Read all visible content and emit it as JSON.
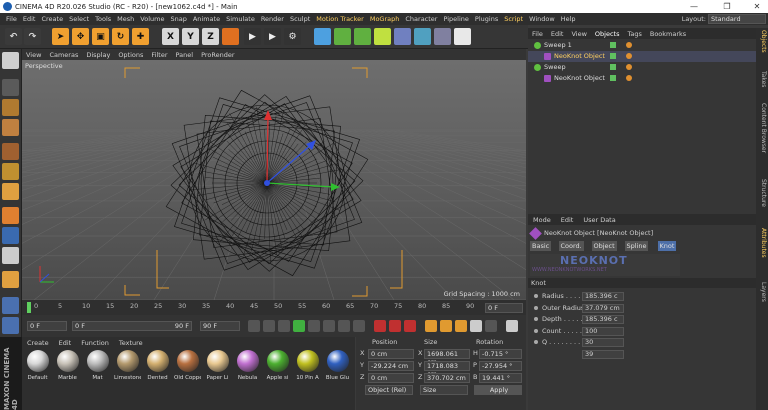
{
  "window": {
    "title": "CINEMA 4D R20.026 Studio (RC - R20) - [new1062.c4d *] - Main",
    "minimize": "—",
    "restore": "❐",
    "close": "✕"
  },
  "menubar": {
    "items": [
      "File",
      "Edit",
      "Create",
      "Select",
      "Tools",
      "Mesh",
      "Volume",
      "Snap",
      "Animate",
      "Simulate",
      "Render",
      "Sculpt",
      "Motion Tracker",
      "MoGraph",
      "Character",
      "Pipeline",
      "Plugins",
      "Script",
      "Window",
      "Help"
    ],
    "layout_label": "Layout:",
    "layout_value": "Standard"
  },
  "toolbar": {
    "axis_x": "X",
    "axis_y": "Y",
    "axis_z": "Z"
  },
  "viewport": {
    "menu": [
      "View",
      "Cameras",
      "Display",
      "Options",
      "Filter",
      "Panel",
      "ProRender"
    ],
    "label": "Perspective",
    "grid_spacing": "Grid Spacing : 1000 cm"
  },
  "timeline": {
    "ticks": [
      "0",
      "5",
      "10",
      "15",
      "20",
      "25",
      "30",
      "35",
      "40",
      "45",
      "50",
      "55",
      "60",
      "65",
      "70",
      "75",
      "80",
      "85",
      "90"
    ],
    "frame_display": "0 F"
  },
  "transport": {
    "start": "0 F",
    "current": "0 F",
    "end_a": "90 F",
    "end_b": "90 F"
  },
  "materials": {
    "menu": [
      "Create",
      "Edit",
      "Function",
      "Texture"
    ],
    "items": [
      {
        "name": "Default",
        "color": "#d8d8d8"
      },
      {
        "name": "Marble",
        "color": "#c8c2b8"
      },
      {
        "name": "Mat",
        "color": "#bdbdbd"
      },
      {
        "name": "Limestone",
        "color": "#b49a6e"
      },
      {
        "name": "Dented",
        "color": "#d4b070"
      },
      {
        "name": "Old Copper",
        "color": "#b87040"
      },
      {
        "name": "Paper Li",
        "color": "#e8c890"
      },
      {
        "name": "Nebula",
        "color": "#c070d0"
      },
      {
        "name": "Apple si",
        "color": "#4cb030"
      },
      {
        "name": "10 Pin A",
        "color": "#c0c020"
      },
      {
        "name": "Blue Glu",
        "color": "#3060c0"
      }
    ]
  },
  "coordinates": {
    "headers": [
      "Position",
      "Size",
      "Rotation"
    ],
    "rows": [
      {
        "axis": "X",
        "pos": "0 cm",
        "size_axis": "X",
        "size": "1698.061 cm",
        "rot_axis": "H",
        "rot": "-0.715 °"
      },
      {
        "axis": "Y",
        "pos": "-29.224 cm",
        "size_axis": "Y",
        "size": "1718.083 cm",
        "rot_axis": "P",
        "rot": "-27.954 °"
      },
      {
        "axis": "Z",
        "pos": "0 cm",
        "size_axis": "Z",
        "size": "370.702 cm",
        "rot_axis": "B",
        "rot": "19.441 °"
      }
    ],
    "mode": "Object (Rel)",
    "size_mode": "Size",
    "apply": "Apply"
  },
  "object_manager": {
    "menu": [
      "File",
      "Edit",
      "View",
      "Objects",
      "Tags",
      "Bookmarks"
    ],
    "rows": [
      {
        "name": "Sweep 1",
        "indent": 0
      },
      {
        "name": "NeoKnot Object",
        "indent": 1
      },
      {
        "name": "Sweep",
        "indent": 0
      },
      {
        "name": "NeoKnot Object",
        "indent": 1
      }
    ]
  },
  "attributes": {
    "menu": [
      "Mode",
      "Edit",
      "User Data"
    ],
    "object_title": "NeoKnot Object [NeoKnot Object]",
    "tabs": [
      "Basic",
      "Coord.",
      "Object",
      "Spline",
      "Knot"
    ],
    "logo": "NEOKNOT",
    "logo_sub": "WWW.NEONKNOTWORKS.NET",
    "section": "Knot",
    "params": [
      {
        "label": "Radius . . . . .",
        "value": "185.396 c"
      },
      {
        "label": "Outer Radius",
        "value": "37.079 cm"
      },
      {
        "label": "Depth . . . . . .",
        "value": "185.396 c"
      },
      {
        "label": "Count . . . . . .",
        "value": "100"
      },
      {
        "label": "Q . . . . . . . . . .",
        "value": "30"
      },
      {
        "label": "",
        "value": "39"
      }
    ]
  },
  "right_tabs": [
    "Objects",
    "Takes",
    "Content Browser",
    "Structure",
    "Attributes",
    "Layers"
  ],
  "branding": "MAXON CINEMA 4D",
  "colors": {
    "accent": "#ffd060",
    "select": "#4d6fa8",
    "knot": "#111111"
  }
}
